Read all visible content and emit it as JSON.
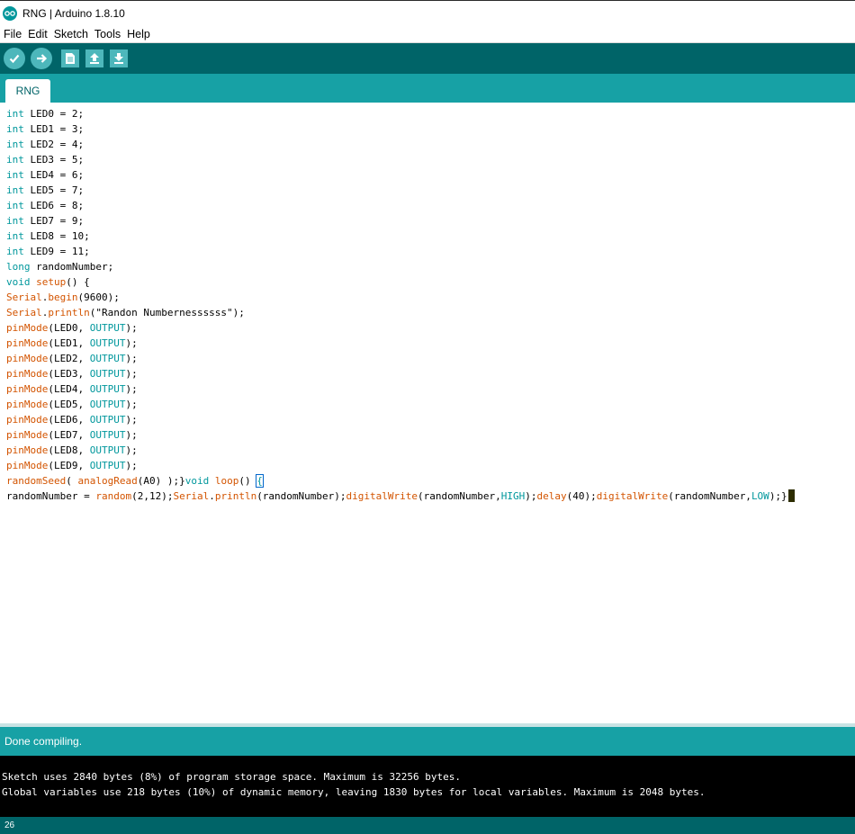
{
  "window": {
    "title": "RNG | Arduino 1.8.10"
  },
  "menu": [
    "File",
    "Edit",
    "Sketch",
    "Tools",
    "Help"
  ],
  "toolbar": {
    "icons": [
      "verify-icon",
      "upload-icon",
      "new-icon",
      "open-icon",
      "save-icon"
    ]
  },
  "tabs": [
    {
      "label": "RNG"
    }
  ],
  "code": {
    "lines": [
      [
        {
          "t": "int",
          "c": "kw"
        },
        {
          "t": " LED0 = 2;"
        }
      ],
      [
        {
          "t": "int",
          "c": "kw"
        },
        {
          "t": " LED1 = 3;"
        }
      ],
      [
        {
          "t": "int",
          "c": "kw"
        },
        {
          "t": " LED2 = 4;"
        }
      ],
      [
        {
          "t": "int",
          "c": "kw"
        },
        {
          "t": " LED3 = 5;"
        }
      ],
      [
        {
          "t": "int",
          "c": "kw"
        },
        {
          "t": " LED4 = 6;"
        }
      ],
      [
        {
          "t": "int",
          "c": "kw"
        },
        {
          "t": " LED5 = 7;"
        }
      ],
      [
        {
          "t": "int",
          "c": "kw"
        },
        {
          "t": " LED6 = 8;"
        }
      ],
      [
        {
          "t": "int",
          "c": "kw"
        },
        {
          "t": " LED7 = 9;"
        }
      ],
      [
        {
          "t": "int",
          "c": "kw"
        },
        {
          "t": " LED8 = 10;"
        }
      ],
      [
        {
          "t": "int",
          "c": "kw"
        },
        {
          "t": " LED9 = 11;"
        }
      ],
      [
        {
          "t": "long",
          "c": "kw"
        },
        {
          "t": " randomNumber;"
        }
      ],
      [
        {
          "t": "void",
          "c": "kw"
        },
        {
          "t": " "
        },
        {
          "t": "setup",
          "c": "fn"
        },
        {
          "t": "() {"
        }
      ],
      [
        {
          "t": "Serial",
          "c": "fn"
        },
        {
          "t": "."
        },
        {
          "t": "begin",
          "c": "fn"
        },
        {
          "t": "(9600);"
        }
      ],
      [
        {
          "t": "Serial",
          "c": "fn"
        },
        {
          "t": "."
        },
        {
          "t": "println",
          "c": "fn"
        },
        {
          "t": "(\"Randon Numbernessssss\");"
        }
      ],
      [
        {
          "t": "pinMode",
          "c": "fn"
        },
        {
          "t": "(LED0, "
        },
        {
          "t": "OUTPUT",
          "c": "cst"
        },
        {
          "t": ");"
        }
      ],
      [
        {
          "t": "pinMode",
          "c": "fn"
        },
        {
          "t": "(LED1, "
        },
        {
          "t": "OUTPUT",
          "c": "cst"
        },
        {
          "t": ");"
        }
      ],
      [
        {
          "t": "pinMode",
          "c": "fn"
        },
        {
          "t": "(LED2, "
        },
        {
          "t": "OUTPUT",
          "c": "cst"
        },
        {
          "t": ");"
        }
      ],
      [
        {
          "t": "pinMode",
          "c": "fn"
        },
        {
          "t": "(LED3, "
        },
        {
          "t": "OUTPUT",
          "c": "cst"
        },
        {
          "t": ");"
        }
      ],
      [
        {
          "t": "pinMode",
          "c": "fn"
        },
        {
          "t": "(LED4, "
        },
        {
          "t": "OUTPUT",
          "c": "cst"
        },
        {
          "t": ");"
        }
      ],
      [
        {
          "t": "pinMode",
          "c": "fn"
        },
        {
          "t": "(LED5, "
        },
        {
          "t": "OUTPUT",
          "c": "cst"
        },
        {
          "t": ");"
        }
      ],
      [
        {
          "t": "pinMode",
          "c": "fn"
        },
        {
          "t": "(LED6, "
        },
        {
          "t": "OUTPUT",
          "c": "cst"
        },
        {
          "t": ");"
        }
      ],
      [
        {
          "t": "pinMode",
          "c": "fn"
        },
        {
          "t": "(LED7, "
        },
        {
          "t": "OUTPUT",
          "c": "cst"
        },
        {
          "t": ");"
        }
      ],
      [
        {
          "t": "pinMode",
          "c": "fn"
        },
        {
          "t": "(LED8, "
        },
        {
          "t": "OUTPUT",
          "c": "cst"
        },
        {
          "t": ");"
        }
      ],
      [
        {
          "t": "pinMode",
          "c": "fn"
        },
        {
          "t": "(LED9, "
        },
        {
          "t": "OUTPUT",
          "c": "cst"
        },
        {
          "t": ");"
        }
      ],
      [
        {
          "t": "randomSeed",
          "c": "fn"
        },
        {
          "t": "( "
        },
        {
          "t": "analogRead",
          "c": "fn"
        },
        {
          "t": "(A0) );}"
        },
        {
          "t": "void",
          "c": "kw"
        },
        {
          "t": " "
        },
        {
          "t": "loop",
          "c": "fn"
        },
        {
          "t": "() "
        },
        {
          "t": "{",
          "c": "hl"
        }
      ],
      [
        {
          "t": "randomNumber = "
        },
        {
          "t": "random",
          "c": "fn"
        },
        {
          "t": "(2,12);"
        },
        {
          "t": "Serial",
          "c": "fn"
        },
        {
          "t": "."
        },
        {
          "t": "println",
          "c": "fn"
        },
        {
          "t": "(randomNumber);"
        },
        {
          "t": "digitalWrite",
          "c": "fn"
        },
        {
          "t": "(randomNumber,"
        },
        {
          "t": "HIGH",
          "c": "cst"
        },
        {
          "t": ");"
        },
        {
          "t": "delay",
          "c": "fn"
        },
        {
          "t": "(40);"
        },
        {
          "t": "digitalWrite",
          "c": "fn"
        },
        {
          "t": "(randomNumber,"
        },
        {
          "t": "LOW",
          "c": "cst"
        },
        {
          "t": ");}"
        },
        {
          "t": "",
          "c": "caret"
        }
      ]
    ]
  },
  "status": {
    "message": "Done compiling."
  },
  "console": {
    "lines": [
      "Sketch uses 2840 bytes (8%) of program storage space. Maximum is 32256 bytes.",
      "Global variables use 218 bytes (10%) of dynamic memory, leaving 1830 bytes for local variables. Maximum is 2048 bytes."
    ]
  },
  "footer": {
    "line_number": "26"
  },
  "colors": {
    "toolbar": "#006468",
    "accent": "#17a1a5",
    "keyword": "#00979c",
    "function": "#d35400"
  }
}
